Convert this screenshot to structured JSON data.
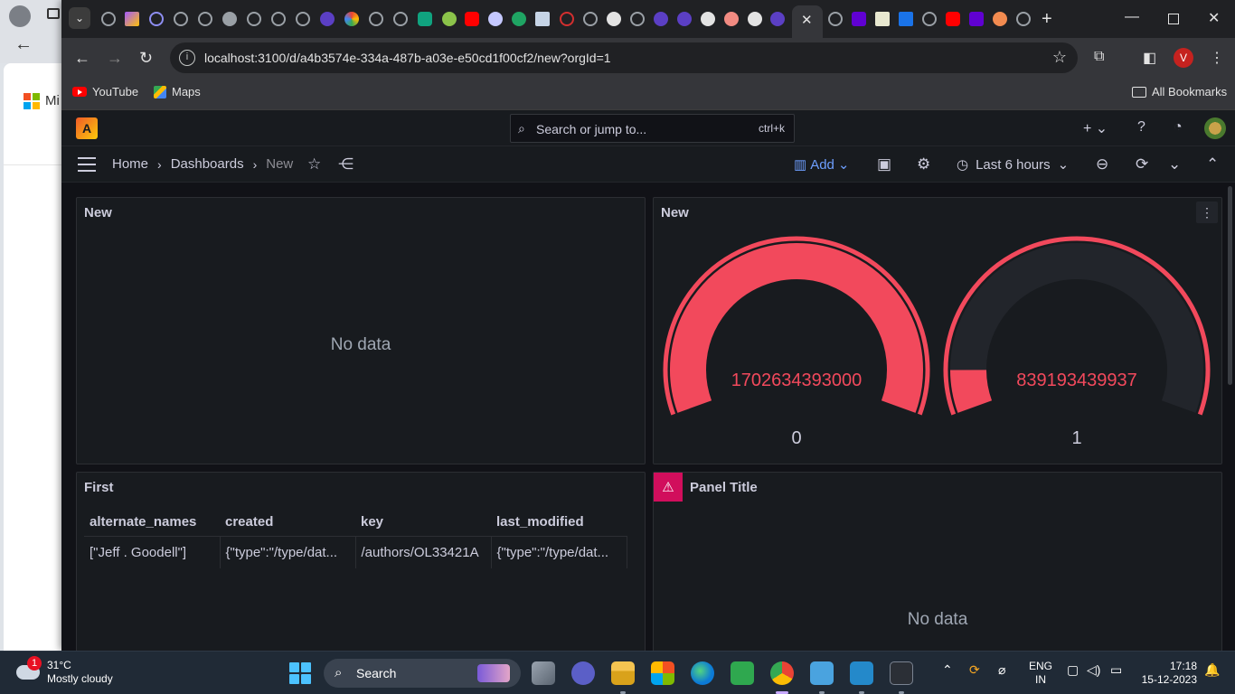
{
  "background_app": {
    "brand_text": "Mi"
  },
  "browser": {
    "url": "localhost:3100/d/a4b3574e-334a-487b-a03e-e50cd1f00cf2/new?orgId=1",
    "profile_initial": "V",
    "bookmarks": [
      {
        "label": "YouTube",
        "icon": "youtube-icon"
      },
      {
        "label": "Maps",
        "icon": "maps-icon"
      }
    ],
    "all_bookmarks_label": "All Bookmarks"
  },
  "grafana": {
    "search_placeholder": "Search or jump to...",
    "search_shortcut": "ctrl+k",
    "breadcrumbs": [
      {
        "label": "Home"
      },
      {
        "label": "Dashboards"
      },
      {
        "label": "New"
      }
    ],
    "add_label": "Add",
    "time_range": "Last 6 hours",
    "colors": {
      "gauge_red": "#f2495c",
      "accent_blue": "#6e9fff",
      "warning_pink": "#d10e5c"
    },
    "panels": {
      "new_left": {
        "title": "New",
        "message": "No data"
      },
      "new_gauges": {
        "title": "New",
        "gauges": [
          {
            "value_text": "1702634393000",
            "label": "0",
            "fill_fraction": 1.0
          },
          {
            "value_text": "839193439937",
            "label": "1",
            "fill_fraction": 0.09
          }
        ]
      },
      "first_table": {
        "title": "First",
        "columns": [
          "alternate_names",
          "created",
          "key",
          "last_modified"
        ],
        "rows": [
          [
            "[\"Jeff . Goodell\"]",
            "{\"type\":\"/type/dat...",
            "/authors/OL33421A",
            "{\"type\":\"/type/dat..."
          ]
        ]
      },
      "panel_title": {
        "title": "Panel Title",
        "message": "No data"
      }
    }
  },
  "taskbar": {
    "weather_temp": "31°C",
    "weather_desc": "Mostly cloudy",
    "notification_count": "1",
    "search_label": "Search",
    "lang_primary": "ENG",
    "lang_secondary": "IN",
    "time": "17:18",
    "date": "15-12-2023"
  }
}
